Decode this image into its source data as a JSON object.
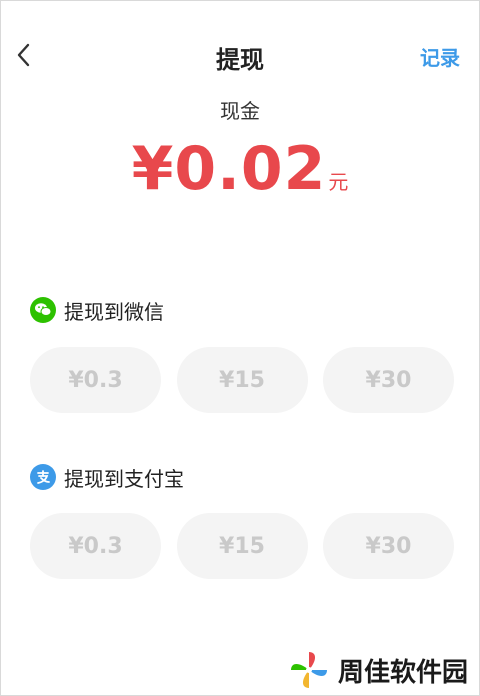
{
  "header": {
    "title": "提现",
    "records_label": "记录",
    "back_icon": "chevron-left-icon"
  },
  "balance": {
    "label": "现金",
    "amount": "¥0.02",
    "unit": "元",
    "color": "#e8484c"
  },
  "wechat": {
    "title": "提现到微信",
    "icon": "wechat-icon",
    "icon_color": "#2dc100",
    "options": [
      "¥0.3",
      "¥15",
      "¥30"
    ]
  },
  "alipay": {
    "title": "提现到支付宝",
    "icon": "alipay-icon",
    "icon_color": "#3d9ae8",
    "options": [
      "¥0.3",
      "¥15",
      "¥30"
    ]
  },
  "watermark": {
    "text": "周佳软件园"
  },
  "colors": {
    "accent_blue": "#3d9ae8",
    "amount_red": "#e8484c",
    "button_bg": "#f4f4f4",
    "button_text_disabled": "#c9c9c9"
  }
}
